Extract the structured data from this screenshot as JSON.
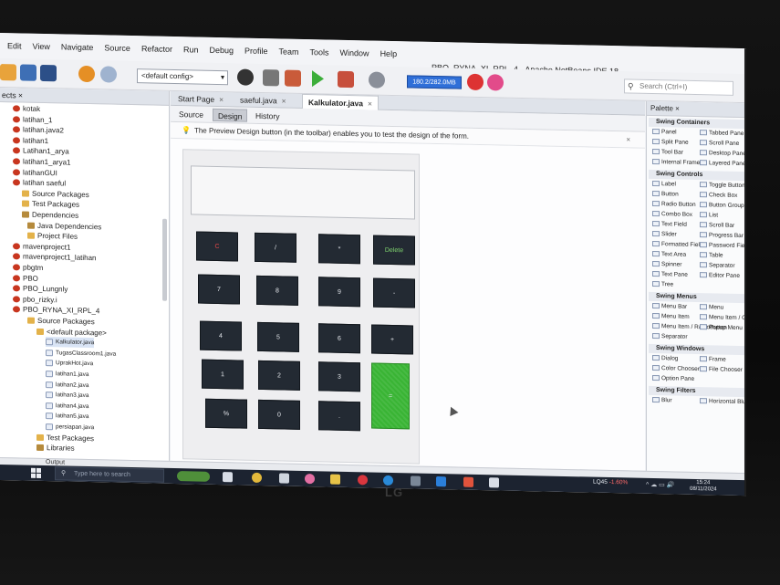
{
  "menu": [
    "Edit",
    "View",
    "Navigate",
    "Source",
    "Refactor",
    "Run",
    "Debug",
    "Profile",
    "Team",
    "Tools",
    "Window",
    "Help"
  ],
  "window_title": "PBO_RYNA_XI_RPL_4 - Apache NetBeans IDE 18",
  "toolbar": {
    "config_value": "<default config>",
    "memory_label": "180.2/282.0MB",
    "search_placeholder": "Search (Ctrl+I)"
  },
  "projects": {
    "tab_label": "ects",
    "items": [
      {
        "label": "kotak",
        "icon": "proj"
      },
      {
        "label": "latihan_1",
        "icon": "proj"
      },
      {
        "label": "latihan.java2",
        "icon": "proj"
      },
      {
        "label": "latihan1",
        "icon": "proj"
      },
      {
        "label": "Latihan1_arya",
        "icon": "proj"
      },
      {
        "label": "latihan1_arya1",
        "icon": "proj"
      },
      {
        "label": "latihanGUI",
        "icon": "proj"
      },
      {
        "label": "latihan saeful",
        "icon": "proj"
      },
      {
        "label": "Source Packages",
        "icon": "pkg"
      },
      {
        "label": "Test Packages",
        "icon": "pkg"
      },
      {
        "label": "Dependencies",
        "icon": "lib"
      },
      {
        "label": "Java Dependencies",
        "icon": "lib"
      },
      {
        "label": "Project Files",
        "icon": "pkg"
      },
      {
        "label": "mavenproject1",
        "icon": "proj"
      },
      {
        "label": "mavenproject1_latihan",
        "icon": "proj"
      },
      {
        "label": "pbgtm",
        "icon": "proj"
      },
      {
        "label": "PBO",
        "icon": "proj"
      },
      {
        "label": "PBO_Lungnly",
        "icon": "proj"
      },
      {
        "label": "pbo_rizky.i",
        "icon": "proj"
      },
      {
        "label": "PBO_RYNA_XI_RPL_4",
        "icon": "proj"
      },
      {
        "label": "Source Packages",
        "icon": "pkg"
      },
      {
        "label": "<default package>",
        "icon": "pkg"
      },
      {
        "label": "Kalkulator.java",
        "icon": "java"
      },
      {
        "label": "TugasClassroom1.java",
        "icon": "java"
      },
      {
        "label": "UprakHot.java",
        "icon": "java"
      },
      {
        "label": "latihan1.java",
        "icon": "java"
      },
      {
        "label": "latihan2.java",
        "icon": "java"
      },
      {
        "label": "latihan3.java",
        "icon": "java"
      },
      {
        "label": "latihan4.java",
        "icon": "java"
      },
      {
        "label": "latihan5.java",
        "icon": "java"
      },
      {
        "label": "persiapan.java",
        "icon": "java"
      },
      {
        "label": "Test Packages",
        "icon": "pkg"
      },
      {
        "label": "Libraries",
        "icon": "lib"
      }
    ]
  },
  "editor": {
    "tabs": [
      {
        "label": "Start Page",
        "active": false
      },
      {
        "label": "saeful.java",
        "active": false
      },
      {
        "label": "Kalkulator.java",
        "active": true
      }
    ],
    "design_tabs": [
      "Source",
      "Design",
      "History"
    ],
    "hint": "The Preview Design button (in the toolbar) enables you to test the design of the form.",
    "calculator_buttons": {
      "c": "C",
      "div": "/",
      "mul": "*",
      "del": "Delete",
      "n7": "7",
      "n8": "8",
      "n9": "9",
      "minus": "-",
      "n4": "4",
      "n5": "5",
      "n6": "6",
      "plus": "+",
      "n1": "1",
      "n2": "2",
      "n3": "3",
      "eq": "=",
      "pct": "%",
      "n0": "0",
      "dot": "."
    }
  },
  "palette": {
    "tab_label": "Palette",
    "swing_containers": "Swing Containers",
    "containers": [
      "Panel",
      "Tabbed Pane",
      "Split Pane",
      "Scroll Pane",
      "Tool Bar",
      "Desktop Pane",
      "Internal Frame",
      "Layered Pane"
    ],
    "swing_controls": "Swing Controls",
    "controls": [
      "Label",
      "Toggle Button",
      "Button",
      "Check Box",
      "Radio Button",
      "Button Group",
      "Combo Box",
      "List",
      "Text Field",
      "Scroll Bar",
      "Slider",
      "Progress Bar",
      "Formatted Field",
      "Password Field",
      "Text Area",
      "Table",
      "Spinner",
      "Separator",
      "Text Pane",
      "Editor Pane",
      "Tree"
    ],
    "swing_menus": "Swing Menus",
    "menus": [
      "Menu Bar",
      "Menu",
      "Menu Item",
      "Menu Item / CheckBox",
      "Menu Item / RadioButton",
      "Popup Menu",
      "Separator"
    ],
    "swing_windows": "Swing Windows",
    "windows": [
      "Dialog",
      "Frame",
      "Color Chooser",
      "File Chooser",
      "Option Pane"
    ],
    "swing_filters": "Swing Filters",
    "filters": [
      "Blur",
      "Horizontal Blur"
    ]
  },
  "output_label": "Output",
  "taskbar": {
    "search_placeholder": "Type here to search",
    "weather": "LQ45",
    "weather_change": "-1.60%",
    "time": "15:24",
    "date": "08/11/2024"
  },
  "monitor_brand": "LG"
}
